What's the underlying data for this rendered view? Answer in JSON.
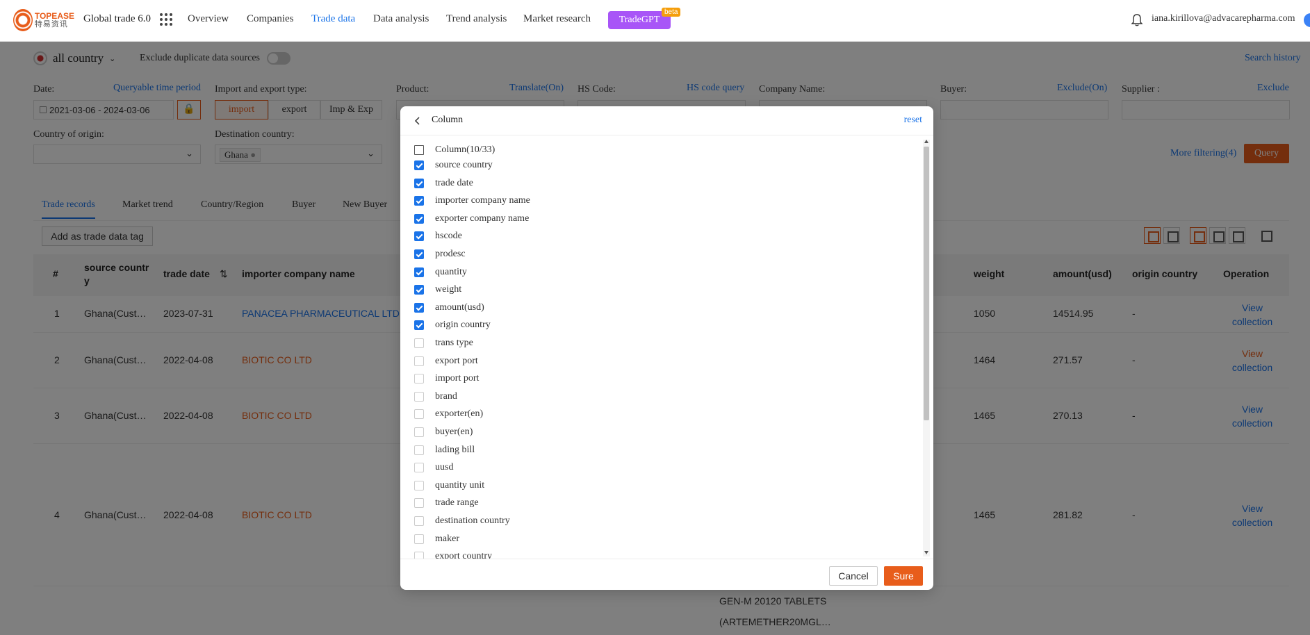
{
  "nav": {
    "logo_en": "TOPEASE",
    "logo_cn": "特易资讯",
    "app_title": "Global trade 6.0",
    "items": [
      "Overview",
      "Companies",
      "Trade data",
      "Data analysis",
      "Trend analysis",
      "Market research"
    ],
    "active_item": "Trade data",
    "tradegpt_label": "TradeGPT",
    "beta_label": "beta",
    "user_email": "iana.kirillova@advacarepharma.com"
  },
  "filters": {
    "country_label": "all country",
    "exclude_dup_label": "Exclude duplicate data sources",
    "search_history": "Search history",
    "date_label": "Date:",
    "date_link": "Queryable time period",
    "date_value": "2021-03-06  -  2024-03-06",
    "ie_label": "Import and export type:",
    "ie_options": [
      "import",
      "export",
      "Imp & Exp"
    ],
    "product_label": "Product:",
    "product_link": "Translate(On)",
    "hs_label": "HS Code:",
    "hs_link": "HS code query",
    "company_label": "Company Name:",
    "buyer_label": "Buyer:",
    "buyer_link": "Exclude(On)",
    "supplier_label": "Supplier :",
    "supplier_link": "Exclude",
    "origin_label": "Country of origin:",
    "dest_label": "Destination country:",
    "dest_tag": "Ghana",
    "more_filtering": "More filtering(4)",
    "query_button": "Query"
  },
  "results": {
    "tabs": [
      "Trade records",
      "Market trend",
      "Country/Region",
      "Buyer",
      "New Buyer"
    ],
    "add_tag_button": "Add as trade data tag",
    "headers": {
      "index": "#",
      "source_country_1": "source countr",
      "source_country_2": "y",
      "trade_date": "trade date",
      "importer": "importer company name",
      "weight": "weight",
      "amount": "amount(usd)",
      "origin": "origin country",
      "operation": "Operation"
    },
    "rows": [
      {
        "idx": "1",
        "country": "Ghana(Cust…",
        "date": "2023-07-31",
        "importer": "PANACEA PHARMACEUTICAL LTD",
        "weight": "1050",
        "amount": "14514.95",
        "origin": "-",
        "op1": "View",
        "op2": "collection"
      },
      {
        "idx": "2",
        "country": "Ghana(Cust…",
        "date": "2022-04-08",
        "importer": "BIOTIC CO LTD",
        "weight": "1464",
        "amount": "271.57",
        "origin": "-",
        "op1": "View",
        "op2": "collection"
      },
      {
        "idx": "3",
        "country": "Ghana(Cust…",
        "date": "2022-04-08",
        "importer": "BIOTIC CO LTD",
        "weight": "1465",
        "amount": "270.13",
        "origin": "-",
        "op1": "View",
        "op2": "collection"
      },
      {
        "idx": "4",
        "country": "Ghana(Cust…",
        "date": "2022-04-08",
        "importer": "BIOTIC CO LTD",
        "weight": "1465",
        "amount": "281.82",
        "origin": "-",
        "op1": "View",
        "op2": "collection"
      }
    ],
    "row5_desc_1": "GEN-M 20120 TABLETS",
    "row5_desc_2": "(ARTEMETHER20MGL…"
  },
  "modal": {
    "title": "Column",
    "reset": "reset",
    "parent_label": "Column(10/33)",
    "columns": [
      {
        "label": "source country",
        "checked": true
      },
      {
        "label": "trade date",
        "checked": true
      },
      {
        "label": "importer company name",
        "checked": true
      },
      {
        "label": "exporter company name",
        "checked": true
      },
      {
        "label": "hscode",
        "checked": true
      },
      {
        "label": "prodesc",
        "checked": true
      },
      {
        "label": "quantity",
        "checked": true
      },
      {
        "label": "weight",
        "checked": true
      },
      {
        "label": "amount(usd)",
        "checked": true
      },
      {
        "label": "origin country",
        "checked": true
      },
      {
        "label": "trans type",
        "checked": false
      },
      {
        "label": "export port",
        "checked": false
      },
      {
        "label": "import port",
        "checked": false
      },
      {
        "label": "brand",
        "checked": false
      },
      {
        "label": "exporter(en)",
        "checked": false
      },
      {
        "label": "buyer(en)",
        "checked": false
      },
      {
        "label": "lading bill",
        "checked": false
      },
      {
        "label": "uusd",
        "checked": false
      },
      {
        "label": "quantity unit",
        "checked": false
      },
      {
        "label": "trade range",
        "checked": false
      },
      {
        "label": "destination country",
        "checked": false
      },
      {
        "label": "maker",
        "checked": false
      },
      {
        "label": "export country",
        "checked": false
      }
    ],
    "cancel": "Cancel",
    "sure": "Sure"
  },
  "colors": {
    "accent": "#e85d1b",
    "link": "#1a73e8",
    "tradegpt": "#a855f7"
  }
}
